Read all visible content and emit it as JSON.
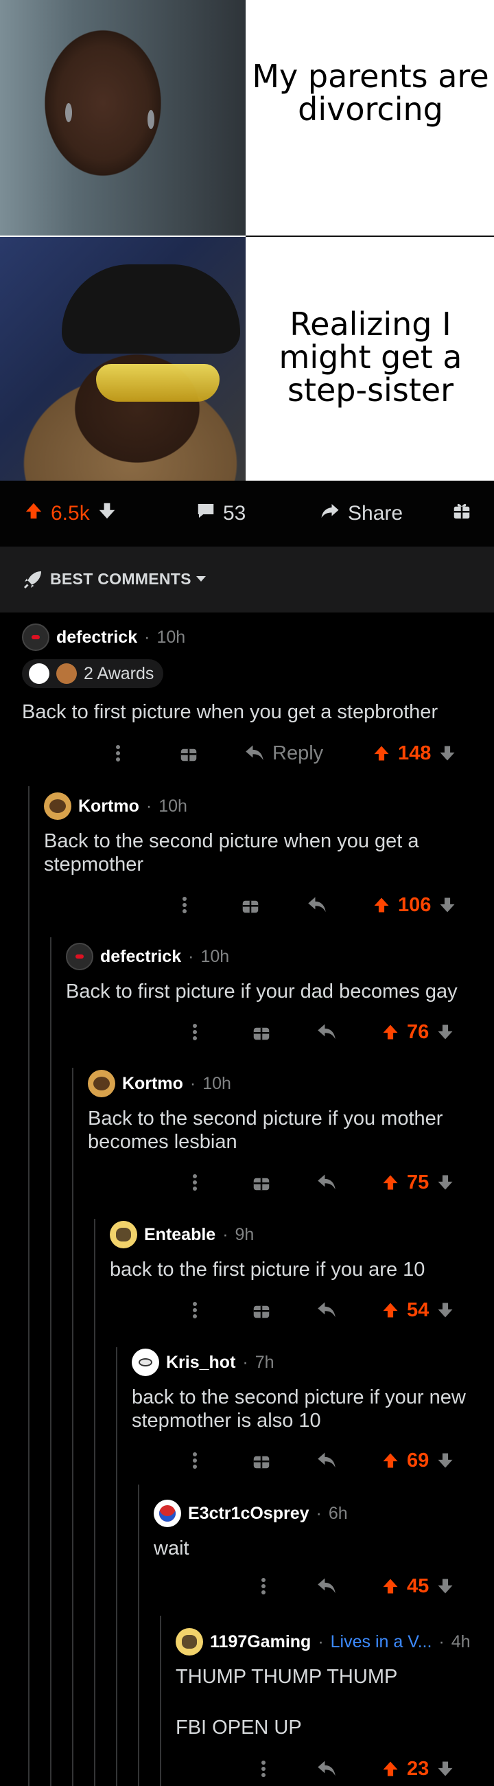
{
  "meme": {
    "top_caption": "My parents are divorcing",
    "bottom_caption": "Realizing I might get a step-sister"
  },
  "post_actions": {
    "upvote_count": "6.5k",
    "comment_count": "53",
    "share_label": "Share"
  },
  "sort": {
    "label": "BEST COMMENTS"
  },
  "comments": [
    {
      "author": "defectrick",
      "time": "10h",
      "awards": "2 Awards",
      "body": "Back to first picture when you get a stepbrother",
      "reply_label": "Reply",
      "score": "148"
    },
    {
      "author": "Kortmo",
      "time": "10h",
      "body": "Back to the second picture when you get a stepmother",
      "score": "106"
    },
    {
      "author": "defectrick",
      "time": "10h",
      "body": "Back to first picture if your dad becomes gay",
      "score": "76"
    },
    {
      "author": "Kortmo",
      "time": "10h",
      "body": "Back to the second picture if you mother becomes lesbian",
      "score": "75"
    },
    {
      "author": "Enteable",
      "time": "9h",
      "body": "back to the first picture if you are 10",
      "score": "54"
    },
    {
      "author": "Kris_hot",
      "time": "7h",
      "body": "back to the second picture if your new stepmother is also 10",
      "score": "69"
    },
    {
      "author": "E3ctr1cOsprey",
      "time": "6h",
      "body": "wait",
      "score": "45"
    },
    {
      "author": "1197Gaming",
      "flair": "Lives in a V...",
      "time": "4h",
      "body": "THUMP THUMP THUMP",
      "body2": "FBI OPEN UP",
      "score": "23"
    }
  ],
  "colors": {
    "accent": "#ff4500",
    "muted": "#818384",
    "flair": "#3d8bff",
    "background": "#000000"
  },
  "icons": [
    "upvote-icon",
    "downvote-icon",
    "comment-icon",
    "share-icon",
    "gift-icon",
    "rocket-icon",
    "caret-down-icon",
    "more-icon",
    "reply-icon"
  ]
}
